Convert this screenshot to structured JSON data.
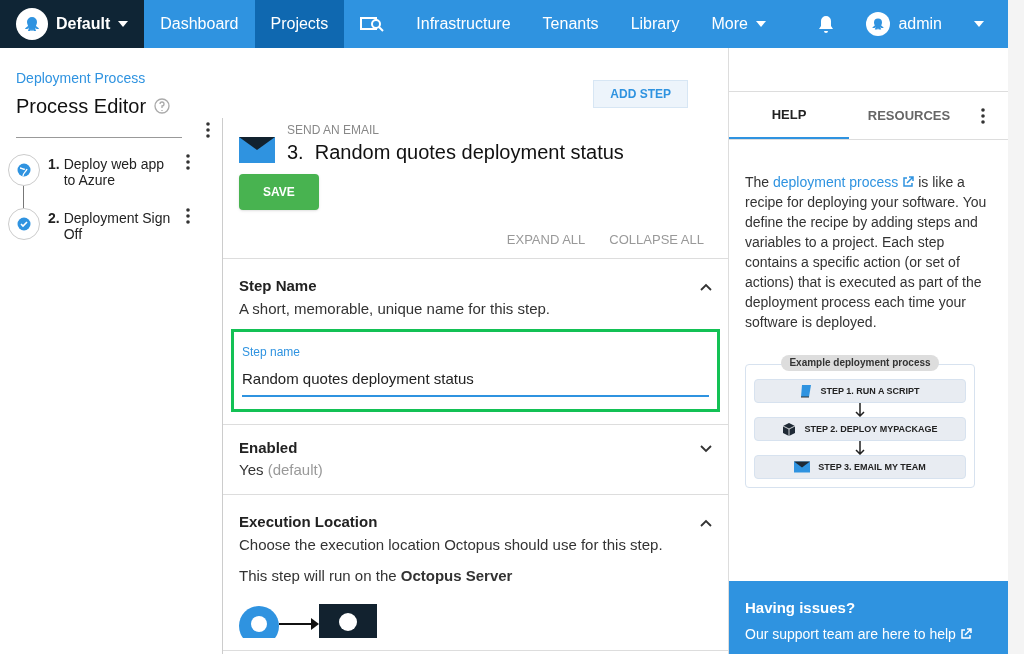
{
  "nav": {
    "space": "Default",
    "items": [
      {
        "kind": "text",
        "label": "Dashboard",
        "selected": false
      },
      {
        "kind": "text",
        "label": "Projects",
        "selected": true
      },
      {
        "kind": "icon",
        "selected": false
      },
      {
        "kind": "text",
        "label": "Infrastructure",
        "selected": false
      },
      {
        "kind": "text",
        "label": "Tenants",
        "selected": false
      },
      {
        "kind": "text",
        "label": "Library",
        "selected": false
      },
      {
        "kind": "menu",
        "label": "More",
        "selected": false
      }
    ],
    "user": "admin"
  },
  "breadcrumb": "Deployment Process",
  "title": "Process Editor",
  "add_step": "ADD STEP",
  "steps": [
    {
      "number": "1.",
      "name": "Deploy web app to Azure",
      "kind": "azure"
    },
    {
      "number": "2.",
      "name": "Deployment Sign Off",
      "kind": "check"
    }
  ],
  "editor": {
    "step_type": "SEND AN EMAIL",
    "step_title": "3.  Random quotes deployment status",
    "save": "SAVE",
    "expand_all": "EXPAND ALL",
    "collapse_all": "COLLAPSE ALL",
    "sections": [
      {
        "kind": "field",
        "title": "Step Name",
        "description": "A short, memorable, unique name for this step.",
        "expanded": true,
        "field_label": "Step name",
        "value": "Random quotes deployment status"
      },
      {
        "kind": "summary",
        "title": "Enabled",
        "value": "Yes",
        "note": "(default)",
        "expanded": false
      },
      {
        "kind": "location",
        "title": "Execution Location",
        "description": "Choose the execution location Octopus should use for this step.",
        "expanded": true,
        "detail": "This step will run on the **Octopus Server**"
      }
    ]
  },
  "help": {
    "tabs": [
      {
        "label": "HELP",
        "selected": true
      },
      {
        "label": "RESOURCES",
        "selected": false
      }
    ],
    "text_before": "The",
    "link": "deployment process",
    "text_after": "is like a recipe for deploying your software. You define the recipe by adding steps and variables to a project. Each step contains a specific action (or set of actions) that is executed as part of the deployment process each time your software is deployed.",
    "diagram": {
      "title": "Example deployment process",
      "steps": [
        {
          "kind": "script",
          "label": "STEP 1. RUN A SCRIPT"
        },
        {
          "kind": "package",
          "label": "STEP 2. DEPLOY MYPACKAGE"
        },
        {
          "kind": "email",
          "label": "STEP 3. EMAIL MY TEAM"
        }
      ]
    },
    "issues": {
      "title": "Having issues?",
      "link": "Our support team are here to help"
    }
  }
}
